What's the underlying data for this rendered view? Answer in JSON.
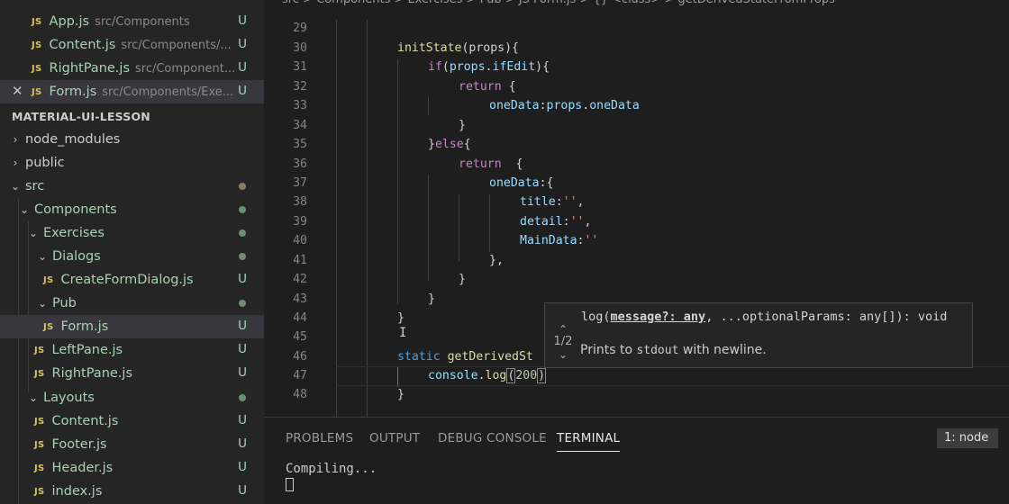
{
  "open_editors": [
    {
      "name": "App.js",
      "path": "src/Components",
      "status": "U"
    },
    {
      "name": "Content.js",
      "path": "src/Components/...",
      "status": "U"
    },
    {
      "name": "RightPane.js",
      "path": "src/Component...",
      "status": "U"
    },
    {
      "name": "Form.js",
      "path": "src/Components/Exe...",
      "status": "U"
    }
  ],
  "explorer": {
    "section_title": "MATERIAL-UI-LESSON",
    "items": [
      {
        "label": "node_modules"
      },
      {
        "label": "public"
      },
      {
        "label": "src"
      },
      {
        "label": "Components"
      },
      {
        "label": "Exercises"
      },
      {
        "label": "Dialogs"
      },
      {
        "label": "CreateFormDialog.js",
        "status": "U"
      },
      {
        "label": "Pub"
      },
      {
        "label": "Form.js",
        "status": "U"
      },
      {
        "label": "LeftPane.js",
        "status": "U"
      },
      {
        "label": "RightPane.js",
        "status": "U"
      },
      {
        "label": "Layouts"
      },
      {
        "label": "Content.js",
        "status": "U"
      },
      {
        "label": "Footer.js",
        "status": "U"
      },
      {
        "label": "Header.js",
        "status": "U"
      },
      {
        "label": "index.js",
        "status": "U"
      }
    ]
  },
  "breadcrumb": "src > Components > Exercises > Pub > JS Form.js > {} <class> > getDerivedStateFromProps",
  "line_numbers": [
    "29",
    "30",
    "31",
    "32",
    "33",
    "34",
    "35",
    "36",
    "37",
    "38",
    "39",
    "40",
    "41",
    "42",
    "43",
    "44",
    "45",
    "46",
    "47",
    "48"
  ],
  "code": {
    "l30_fn": "initState",
    "l30_rest": "(props){",
    "l31_kw": "if",
    "l31_a": "(",
    "l31_var": "props",
    "l31_b": ".",
    "l31_var2": "ifEdit",
    "l31_c": "){",
    "l32_kw": "return",
    "l32_rest": " {",
    "l33_var": "oneData",
    "l33_a": ":",
    "l33_var2": "props",
    "l33_b": ".",
    "l33_var3": "oneData",
    "l34": "}",
    "l35_a": "}",
    "l35_kw": "else",
    "l35_b": "{",
    "l36_kw": "return",
    "l36_rest": "  {",
    "l37_var": "oneData",
    "l37_rest": ":{",
    "l38_var": "title",
    "l38_a": ":",
    "l38_str": "''",
    "l38_b": ",",
    "l39_var": "detail",
    "l39_a": ":",
    "l39_str": "''",
    "l39_b": ",",
    "l40_var": "MainData",
    "l40_a": ":",
    "l40_str": "''",
    "l41": "},",
    "l42": "}",
    "l43": "}",
    "l44": "}",
    "l46_kw": "static",
    "l46_fn": " getDerivedSt",
    "l47_var": "console",
    "l47_a": ".",
    "l47_fn": "log",
    "l47_b": "(",
    "l47_num": "200",
    "l47_c": ")",
    "l48": "}"
  },
  "hover": {
    "sig_fn": "log(",
    "sig_param": "message?: any",
    "sig_rest": ", ...optionalParams: any[]): void",
    "desc_pre": "Prints to ",
    "desc_code": "stdout",
    "desc_post": " with newline.",
    "nav": "1/2"
  },
  "panel": {
    "tabs": [
      "PROBLEMS",
      "OUTPUT",
      "DEBUG CONSOLE",
      "TERMINAL"
    ],
    "active_tab": "TERMINAL",
    "terminal_select": "1: node",
    "terminal_output": "Compiling..."
  },
  "colors": {
    "untracked": "#a9d2b4",
    "js_icon": "#d8c35a",
    "function": "#dcdcaa",
    "keyword": "#c586c0",
    "variable": "#9cdcfe",
    "string": "#ce9178"
  }
}
